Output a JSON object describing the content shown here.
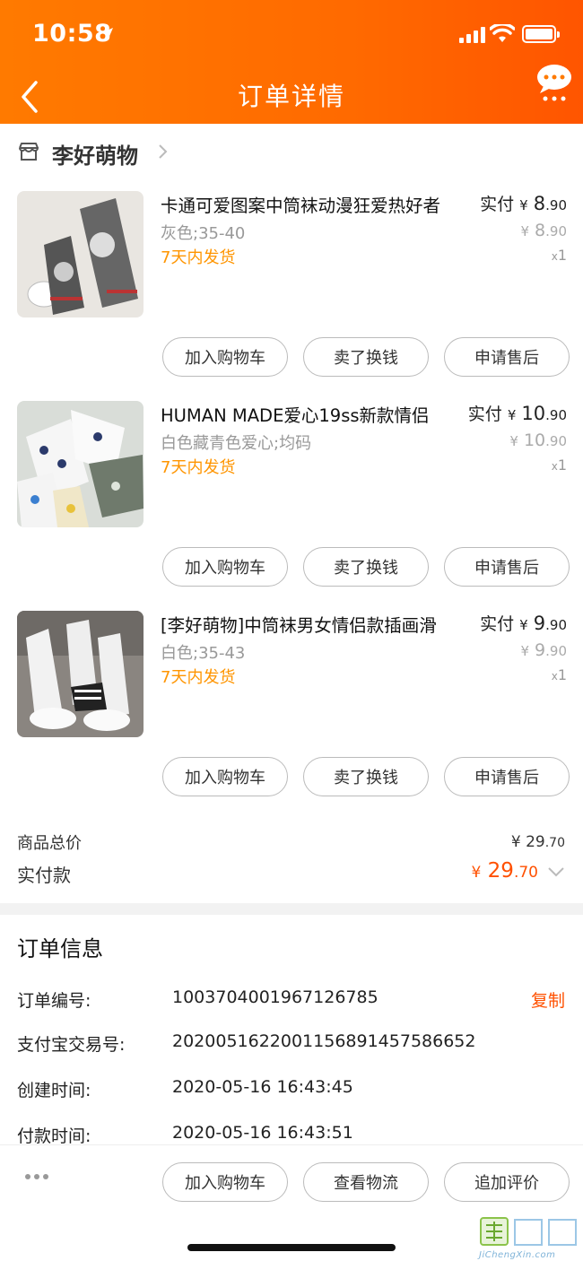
{
  "status_bar": {
    "time": "10:58"
  },
  "nav": {
    "title": "订单详情"
  },
  "shop": {
    "name": "李好萌物"
  },
  "items": [
    {
      "title": "卡通可爱图案中筒袜动漫狂爱热好者",
      "spec": "灰色;35-40",
      "shipping": "7天内发货",
      "paid_label": "实付",
      "currency": "¥",
      "price_int": "8",
      "price_dec": ".90",
      "orig_int": "8",
      "orig_dec": ".90",
      "qty_x": "x",
      "qty": "1",
      "buttons": [
        "加入购物车",
        "卖了换钱",
        "申请售后"
      ]
    },
    {
      "title": "HUMAN MADE爱心19ss新款情侣",
      "spec": "白色藏青色爱心;均码",
      "shipping": "7天内发货",
      "paid_label": "实付",
      "currency": "¥",
      "price_int": "10",
      "price_dec": ".90",
      "orig_int": "10",
      "orig_dec": ".90",
      "qty_x": "x",
      "qty": "1",
      "buttons": [
        "加入购物车",
        "卖了换钱",
        "申请售后"
      ]
    },
    {
      "title": "[李好萌物]中筒袜男女情侣款插画滑",
      "spec": "白色;35-43",
      "shipping": "7天内发货",
      "paid_label": "实付",
      "currency": "¥",
      "price_int": "9",
      "price_dec": ".90",
      "orig_int": "9",
      "orig_dec": ".90",
      "qty_x": "x",
      "qty": "1",
      "buttons": [
        "加入购物车",
        "卖了换钱",
        "申请售后"
      ]
    }
  ],
  "totals": {
    "goods_total_label": "商品总价",
    "goods_total_currency": "¥",
    "goods_total_int": "29",
    "goods_total_dec": ".70",
    "paid_label": "实付款",
    "paid_currency": "¥",
    "paid_int": "29",
    "paid_dec": ".70"
  },
  "order_info": {
    "title": "订单信息",
    "rows": [
      {
        "label": "订单编号:",
        "value": "1003704001967126785",
        "action": "复制"
      },
      {
        "label": "支付宝交易号:",
        "value": "2020051622001156891457586652"
      },
      {
        "label": "创建时间:",
        "value": "2020-05-16 16:43:45"
      },
      {
        "label": "付款时间:",
        "value": "2020-05-16 16:43:51"
      }
    ]
  },
  "bottom_bar": {
    "buttons": [
      "加入购物车",
      "查看物流",
      "追加评价"
    ]
  },
  "watermark": {
    "text": "JiChengXin.com"
  },
  "colors": {
    "header_orange": "#ff6a00",
    "accent_orange": "#ff5000",
    "shipping_orange": "#ff9500"
  }
}
